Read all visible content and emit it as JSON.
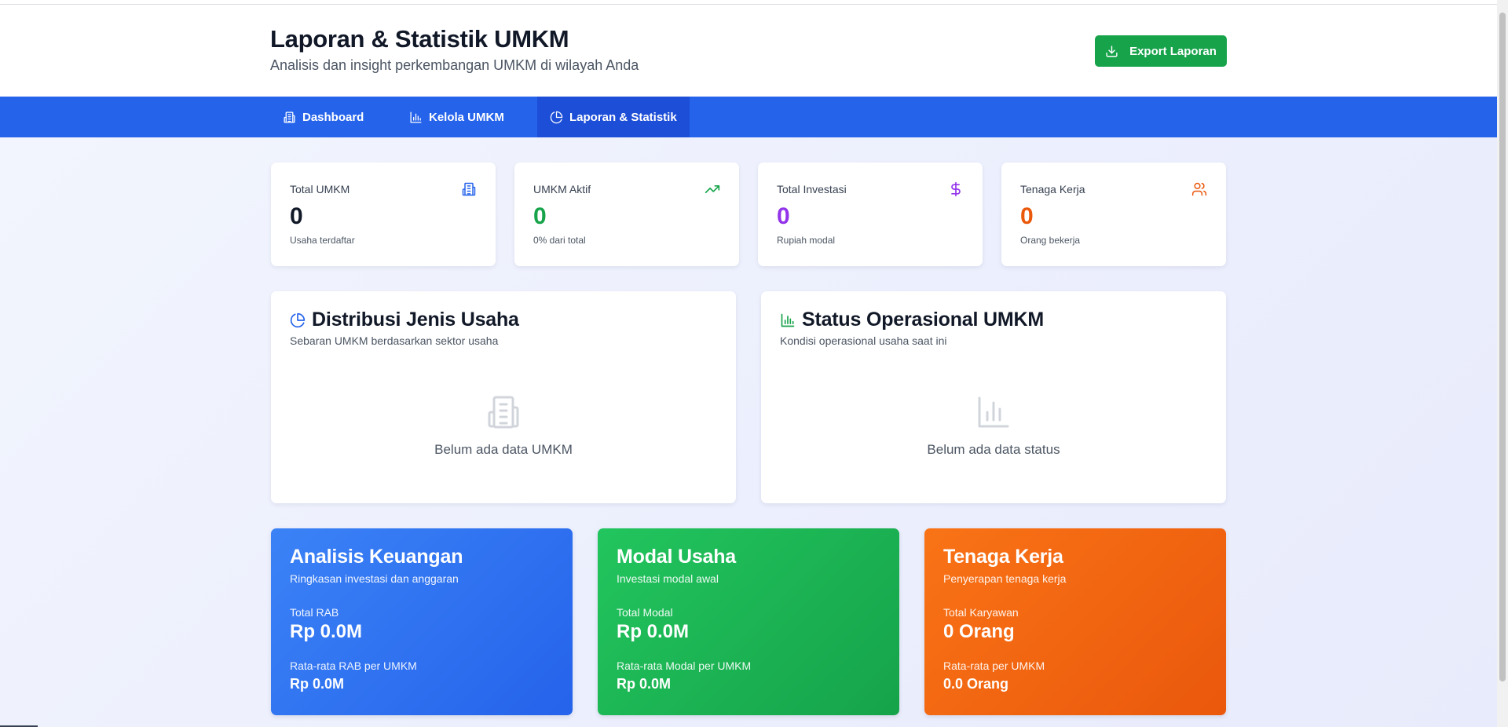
{
  "header": {
    "title": "Laporan & Statistik UMKM",
    "subtitle": "Analisis dan insight perkembangan UMKM di wilayah Anda",
    "export_label": "Export Laporan",
    "export_icon": "download-icon"
  },
  "nav": {
    "tabs": [
      {
        "label": "Dashboard",
        "icon": "building-icon"
      },
      {
        "label": "Kelola UMKM",
        "icon": "bar-chart-icon"
      },
      {
        "label": "Laporan & Statistik",
        "icon": "pie-chart-icon",
        "active": true
      }
    ]
  },
  "stats": [
    {
      "label": "Total UMKM",
      "value": "0",
      "note": "Usaha terdaftar",
      "icon": "building-icon",
      "color": "#111827",
      "icon_color": "#2563eb"
    },
    {
      "label": "UMKM Aktif",
      "value": "0",
      "note": "0% dari total",
      "icon": "trending-up-icon",
      "color": "#16a34a",
      "icon_color": "#16a34a"
    },
    {
      "label": "Total Investasi",
      "value": "0",
      "note": "Rupiah modal",
      "icon": "dollar-icon",
      "color": "#9333ea",
      "icon_color": "#9333ea"
    },
    {
      "label": "Tenaga Kerja",
      "value": "0",
      "note": "Orang bekerja",
      "icon": "users-icon",
      "color": "#ea580c",
      "icon_color": "#ea580c"
    }
  ],
  "panels": [
    {
      "title": "Distribusi Jenis Usaha",
      "subtitle": "Sebaran UMKM berdasarkan sektor usaha",
      "empty_text": "Belum ada data UMKM",
      "title_icon": "pie-chart-icon",
      "empty_icon": "building-icon"
    },
    {
      "title": "Status Operasional UMKM",
      "subtitle": "Kondisi operasional usaha saat ini",
      "empty_text": "Belum ada data status",
      "title_icon": "bar-chart-icon",
      "empty_icon": "bar-chart-icon"
    }
  ],
  "summary": [
    {
      "title": "Analisis Keuangan",
      "subtitle": "Ringkasan investasi dan anggaran",
      "label1": "Total RAB",
      "value1": "Rp 0.0M",
      "label2": "Rata-rata RAB per UMKM",
      "value2": "Rp 0.0M"
    },
    {
      "title": "Modal Usaha",
      "subtitle": "Investasi modal awal",
      "label1": "Total Modal",
      "value1": "Rp 0.0M",
      "label2": "Rata-rata Modal per UMKM",
      "value2": "Rp 0.0M"
    },
    {
      "title": "Tenaga Kerja",
      "subtitle": "Penyerapan tenaga kerja",
      "label1": "Total Karyawan",
      "value1": "0 Orang",
      "label2": "Rata-rata per UMKM",
      "value2": "0.0 Orang"
    }
  ]
}
